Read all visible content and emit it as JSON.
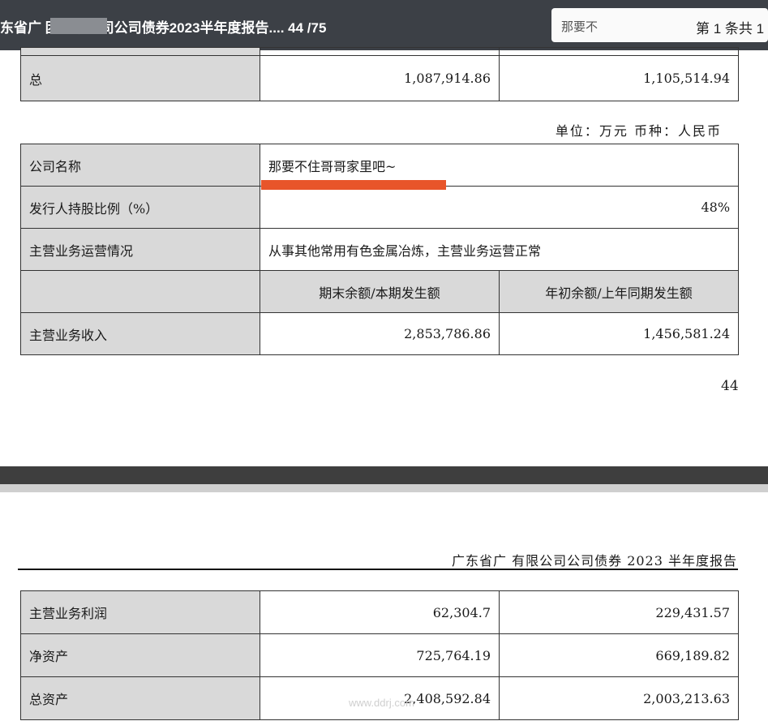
{
  "toolbar": {
    "doc_title": "东省广 团有限公司公司债券2023半年度报告.... 44 /75",
    "search_value": "那要不",
    "search_count": "第 1 条共 1"
  },
  "table1": {
    "row_total": {
      "label": "总",
      "current": "1,087,914.86",
      "previous": "1,105,514.94"
    }
  },
  "unit_note": "单位：万元   币种：人民币",
  "table2": {
    "company_label": "公司名称",
    "company_value": "那要不住哥哥家里吧~",
    "holding_label": "发行人持股比例（%）",
    "holding_value": "48%",
    "business_label": "主营业务运营情况",
    "business_value": "从事其他常用有色金属冶炼，主营业务运营正常",
    "col_current": "期末余额/本期发生额",
    "col_previous": "年初余额/上年同期发生额",
    "revenue_label": "主营业务收入",
    "revenue_current": "2,853,786.86",
    "revenue_previous": "1,456,581.24"
  },
  "page_number": "44",
  "next_page_header": "广东省广 有限公司公司债券 2023 半年度报告",
  "table3": {
    "rows": [
      {
        "label": "主营业务利润",
        "current": "62,304.7",
        "previous": "229,431.57"
      },
      {
        "label": "净资产",
        "current": "725,764.19",
        "previous": "669,189.82"
      },
      {
        "label": "总资产",
        "current": "2,408,592.84",
        "previous": "2,003,213.63"
      }
    ]
  },
  "watermark": "www.ddrj.com"
}
